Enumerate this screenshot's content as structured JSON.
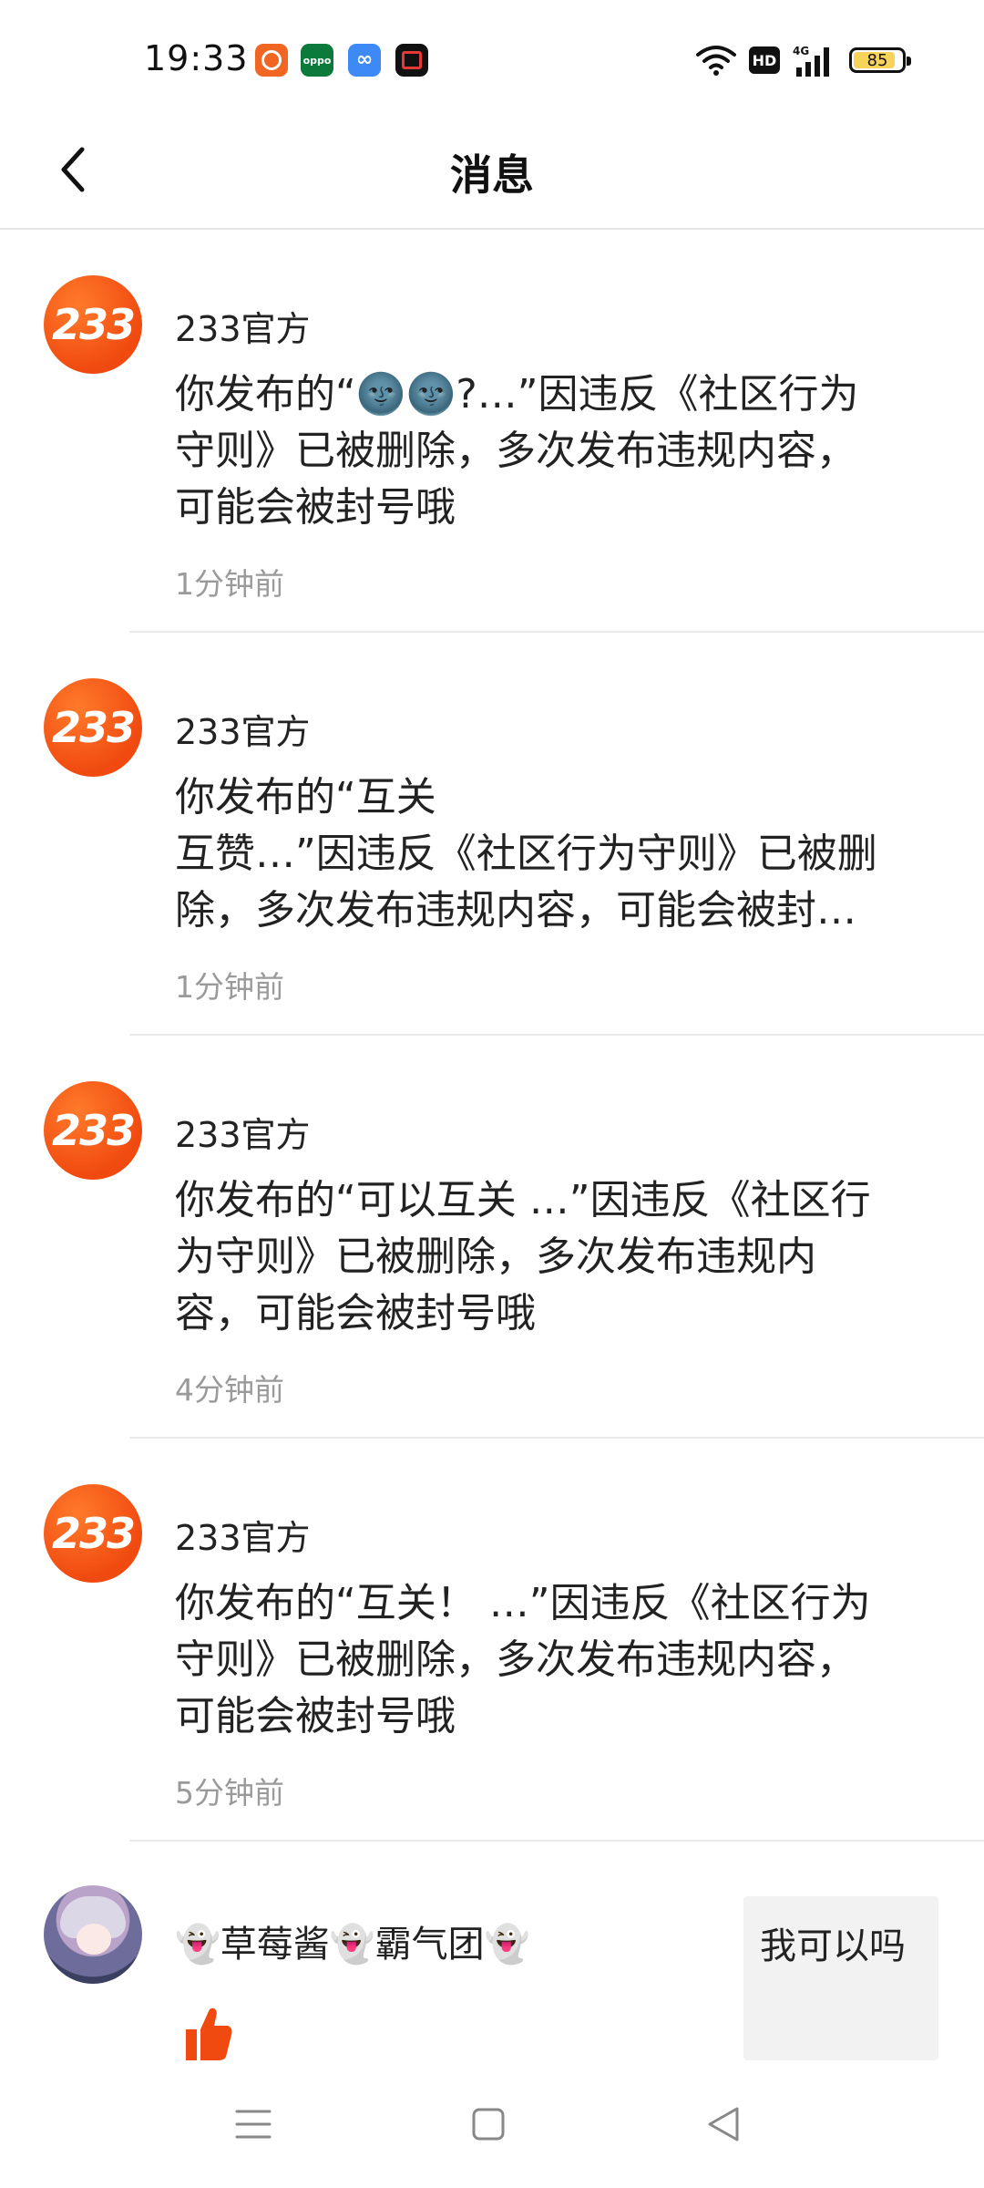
{
  "status_bar": {
    "time": "19:33",
    "app_icons": [
      "photo-icon",
      "oppo-icon",
      "cloud-link-icon",
      "screen-record-icon"
    ],
    "app_label_oppo": "oppo",
    "hd": "HD",
    "network": "4G",
    "battery": "85",
    "battery_color": "#f7d35a"
  },
  "header": {
    "title": "消息"
  },
  "messages": [
    {
      "avatar_text": "233",
      "sender": "233官方",
      "content": "你发布的“🌚🌚?…”因违反《社区行为守则》已被删除，多次发布违规内容，可能会被封号哦",
      "time": "1分钟前"
    },
    {
      "avatar_text": "233",
      "sender": "233官方",
      "content": "你发布的“互关\n互赞…”因违反《社区行为守则》已被删除，多次发布违规内容，可能会被封号哦",
      "time": "1分钟前"
    },
    {
      "avatar_text": "233",
      "sender": "233官方",
      "content": "你发布的“可以互关 …”因违反《社区行为守则》已被删除，多次发布违规内容，可能会被封号哦",
      "time": "4分钟前"
    },
    {
      "avatar_text": "233",
      "sender": "233官方",
      "content": "你发布的“互关！ …”因违反《社区行为守则》已被删除，多次发布违规内容，可能会被封号哦",
      "time": "5分钟前"
    }
  ],
  "last_item": {
    "user_name": "👻草莓酱👻霸气团👻",
    "quoted_text": "我可以吗",
    "like_color": "#f04a10"
  },
  "colors": {
    "accent": "#f04a10",
    "muted_text": "#9a9a9a",
    "divider": "#eaeaea"
  }
}
